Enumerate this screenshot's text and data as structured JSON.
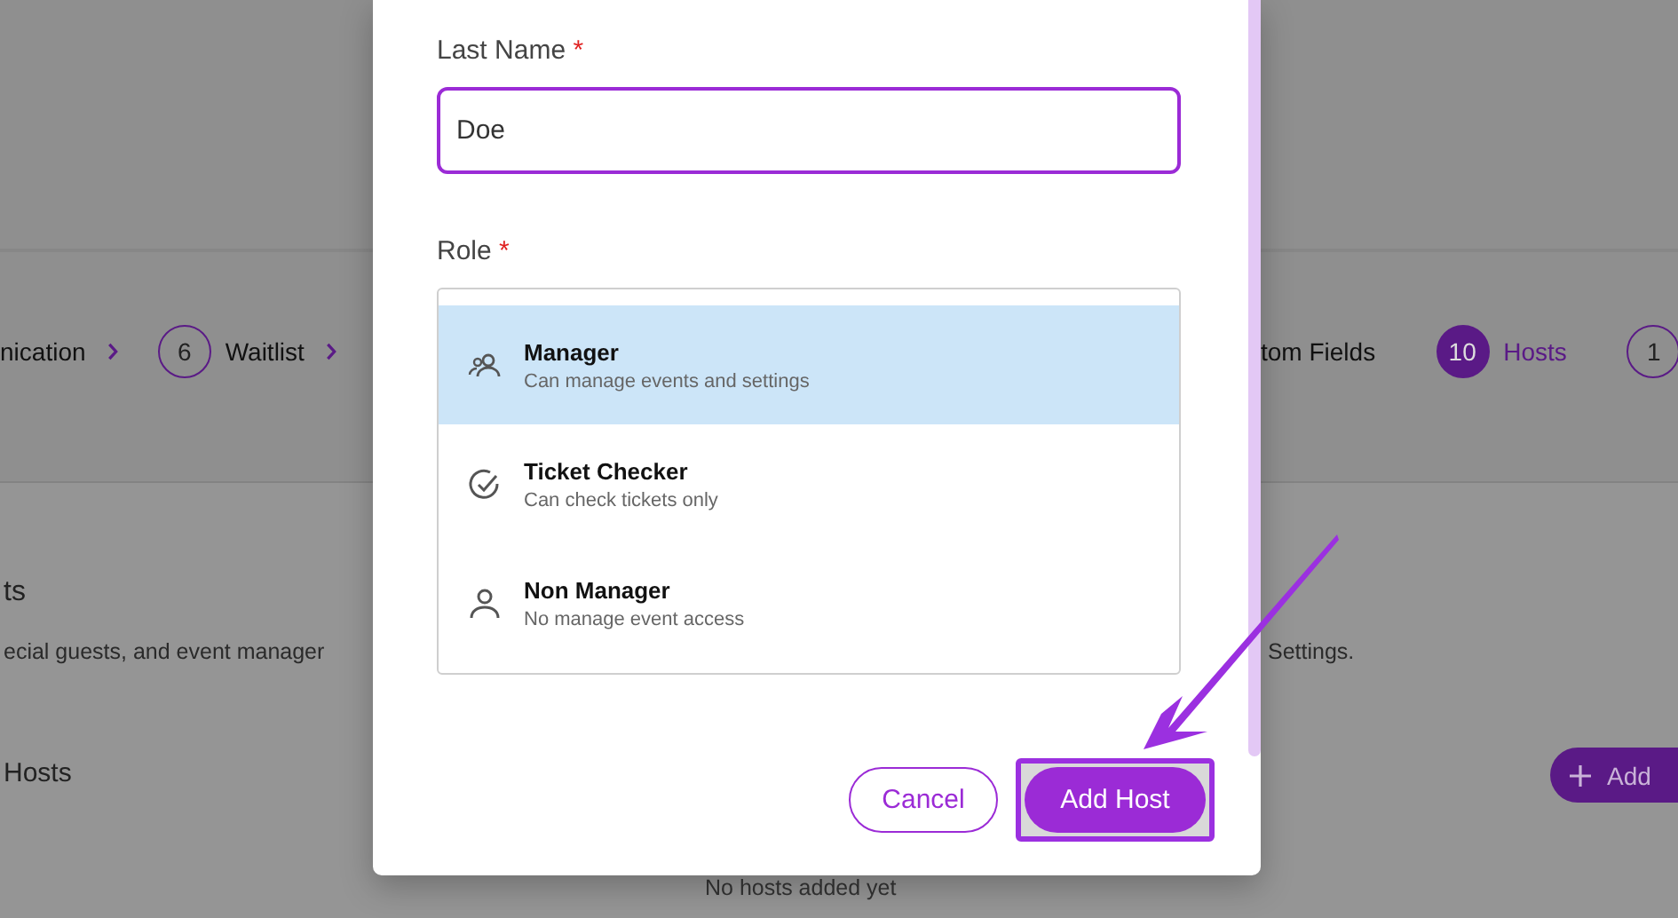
{
  "background": {
    "steps_left": [
      {
        "label": "nication"
      },
      {
        "number": "6",
        "label": "Waitlist",
        "current": false
      }
    ],
    "steps_right": [
      {
        "label": "tom Fields"
      },
      {
        "number": "10",
        "label": "Hosts",
        "current": true
      },
      {
        "number": "1",
        "current": false
      }
    ],
    "section_heading": "ts",
    "description_left": "ecial guests, and event manager",
    "description_right": "Settings.",
    "hosts_heading": "Hosts",
    "add_button": "Add",
    "empty_text": "No hosts added yet"
  },
  "modal": {
    "last_name": {
      "label": "Last Name",
      "required_mark": "*",
      "value": "Doe"
    },
    "role": {
      "label": "Role",
      "required_mark": "*",
      "options": [
        {
          "kind": "group",
          "title": "Manager",
          "description": "Can manage events and settings",
          "selected": true
        },
        {
          "kind": "check",
          "title": "Ticket Checker",
          "description": "Can check tickets only",
          "selected": false
        },
        {
          "kind": "person",
          "title": "Non Manager",
          "description": "No manage event access",
          "selected": false
        }
      ]
    },
    "cancel_button": "Cancel",
    "submit_button": "Add Host"
  }
}
